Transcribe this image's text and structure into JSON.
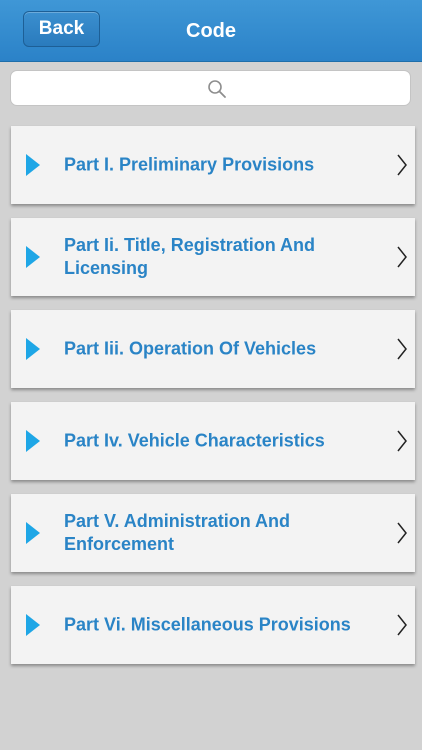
{
  "navbar": {
    "back_label": "Back",
    "title": "Code"
  },
  "search": {
    "placeholder": ""
  },
  "items": [
    {
      "label": "Part I. Preliminary Provisions"
    },
    {
      "label": "Part Ii. Title, Registration And Licensing"
    },
    {
      "label": "Part Iii. Operation Of Vehicles"
    },
    {
      "label": "Part Iv. Vehicle Characteristics"
    },
    {
      "label": "Part V. Administration And Enforcement"
    },
    {
      "label": "Part Vi. Miscellaneous Provisions"
    }
  ],
  "icons": {
    "search": "search-icon",
    "expand": "triangle-right-icon",
    "disclosure": "chevron-right-icon"
  },
  "colors": {
    "navbar": "#2b82c8",
    "label": "#2a84c6",
    "triangle": "#1ea6e6",
    "background": "#d2d2d2"
  }
}
